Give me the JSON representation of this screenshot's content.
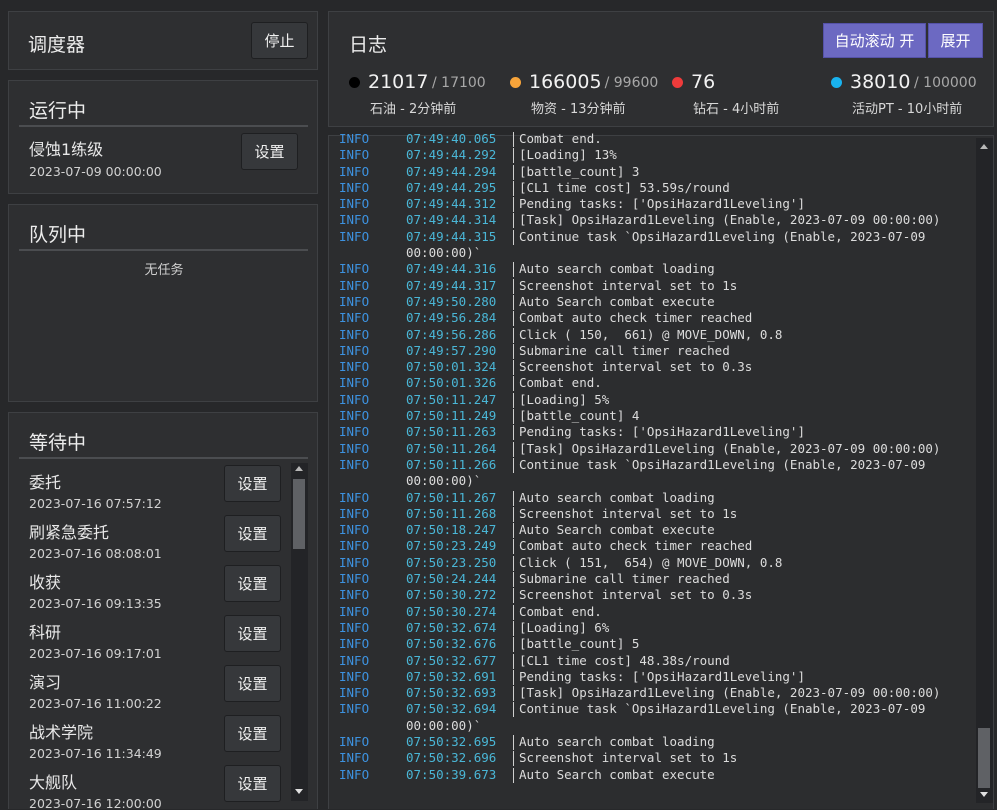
{
  "scheduler": {
    "title": "调度器",
    "stop_label": "停止"
  },
  "running": {
    "title": "运行中",
    "task": {
      "name": "侵蚀1练级",
      "date": "2023-07-09 00:00:00",
      "settings_label": "设置"
    }
  },
  "queue": {
    "title": "队列中",
    "empty_text": "无任务"
  },
  "waiting": {
    "title": "等待中",
    "items": [
      {
        "name": "委托",
        "date": "2023-07-16 07:57:12",
        "settings_label": "设置"
      },
      {
        "name": "刷紧急委托",
        "date": "2023-07-16 08:08:01",
        "settings_label": "设置"
      },
      {
        "name": "收获",
        "date": "2023-07-16 09:13:35",
        "settings_label": "设置"
      },
      {
        "name": "科研",
        "date": "2023-07-16 09:17:01",
        "settings_label": "设置"
      },
      {
        "name": "演习",
        "date": "2023-07-16 11:00:22",
        "settings_label": "设置"
      },
      {
        "name": "战术学院",
        "date": "2023-07-16 11:34:49",
        "settings_label": "设置"
      },
      {
        "name": "大舰队",
        "date": "2023-07-16 12:00:00",
        "settings_label": "设置"
      }
    ]
  },
  "log_panel": {
    "title": "日志",
    "auto_scroll_label": "自动滚动 开",
    "expand_label": "展开",
    "stats": [
      {
        "value": "21017",
        "limit": "/ 17100",
        "label": "石油 - 2分钟前",
        "color": "#000000"
      },
      {
        "value": "166005",
        "limit": "/ 99600",
        "label": "物资 - 13分钟前",
        "color": "#f7a43a"
      },
      {
        "value": "76",
        "limit": "",
        "label": "钻石 - 4小时前",
        "color": "#ee3b3b"
      },
      {
        "value": "38010",
        "limit": "/ 100000",
        "label": "活动PT - 10小时前",
        "color": "#19b3ef"
      }
    ],
    "lines": [
      {
        "level": "INFO",
        "time": "07:49:40.065",
        "msg": "Combat end."
      },
      {
        "level": "INFO",
        "time": "07:49:44.292",
        "msg": "[Loading] 13%"
      },
      {
        "level": "INFO",
        "time": "07:49:44.294",
        "msg": "[battle_count] 3"
      },
      {
        "level": "INFO",
        "time": "07:49:44.295",
        "msg": "[CL1 time cost] 53.59s/round"
      },
      {
        "level": "INFO",
        "time": "07:49:44.312",
        "msg": "Pending tasks: ['OpsiHazard1Leveling']"
      },
      {
        "level": "INFO",
        "time": "07:49:44.314",
        "msg": "[Task] OpsiHazard1Leveling (Enable, 2023-07-09 00:00:00)"
      },
      {
        "level": "INFO",
        "time": "07:49:44.315",
        "msg": "Continue task `OpsiHazard1Leveling (Enable, 2023-07-09"
      },
      {
        "level": "",
        "time": "",
        "msg": "",
        "cont": "00:00:00)`"
      },
      {
        "level": "INFO",
        "time": "07:49:44.316",
        "msg": "Auto search combat loading"
      },
      {
        "level": "INFO",
        "time": "07:49:44.317",
        "msg": "Screenshot interval set to 1s"
      },
      {
        "level": "INFO",
        "time": "07:49:50.280",
        "msg": "Auto Search combat execute"
      },
      {
        "level": "INFO",
        "time": "07:49:56.284",
        "msg": "Combat auto check timer reached"
      },
      {
        "level": "INFO",
        "time": "07:49:56.286",
        "msg": "Click ( 150,  661) @ MOVE_DOWN, 0.8"
      },
      {
        "level": "INFO",
        "time": "07:49:57.290",
        "msg": "Submarine call timer reached"
      },
      {
        "level": "INFO",
        "time": "07:50:01.324",
        "msg": "Screenshot interval set to 0.3s"
      },
      {
        "level": "INFO",
        "time": "07:50:01.326",
        "msg": "Combat end."
      },
      {
        "level": "INFO",
        "time": "07:50:11.247",
        "msg": "[Loading] 5%"
      },
      {
        "level": "INFO",
        "time": "07:50:11.249",
        "msg": "[battle_count] 4"
      },
      {
        "level": "INFO",
        "time": "07:50:11.263",
        "msg": "Pending tasks: ['OpsiHazard1Leveling']"
      },
      {
        "level": "INFO",
        "time": "07:50:11.264",
        "msg": "[Task] OpsiHazard1Leveling (Enable, 2023-07-09 00:00:00)"
      },
      {
        "level": "INFO",
        "time": "07:50:11.266",
        "msg": "Continue task `OpsiHazard1Leveling (Enable, 2023-07-09"
      },
      {
        "level": "",
        "time": "",
        "msg": "",
        "cont": "00:00:00)`"
      },
      {
        "level": "INFO",
        "time": "07:50:11.267",
        "msg": "Auto search combat loading"
      },
      {
        "level": "INFO",
        "time": "07:50:11.268",
        "msg": "Screenshot interval set to 1s"
      },
      {
        "level": "INFO",
        "time": "07:50:18.247",
        "msg": "Auto Search combat execute"
      },
      {
        "level": "INFO",
        "time": "07:50:23.249",
        "msg": "Combat auto check timer reached"
      },
      {
        "level": "INFO",
        "time": "07:50:23.250",
        "msg": "Click ( 151,  654) @ MOVE_DOWN, 0.8"
      },
      {
        "level": "INFO",
        "time": "07:50:24.244",
        "msg": "Submarine call timer reached"
      },
      {
        "level": "INFO",
        "time": "07:50:30.272",
        "msg": "Screenshot interval set to 0.3s"
      },
      {
        "level": "INFO",
        "time": "07:50:30.274",
        "msg": "Combat end."
      },
      {
        "level": "INFO",
        "time": "07:50:32.674",
        "msg": "[Loading] 6%"
      },
      {
        "level": "INFO",
        "time": "07:50:32.676",
        "msg": "[battle_count] 5"
      },
      {
        "level": "INFO",
        "time": "07:50:32.677",
        "msg": "[CL1 time cost] 48.38s/round"
      },
      {
        "level": "INFO",
        "time": "07:50:32.691",
        "msg": "Pending tasks: ['OpsiHazard1Leveling']"
      },
      {
        "level": "INFO",
        "time": "07:50:32.693",
        "msg": "[Task] OpsiHazard1Leveling (Enable, 2023-07-09 00:00:00)"
      },
      {
        "level": "INFO",
        "time": "07:50:32.694",
        "msg": "Continue task `OpsiHazard1Leveling (Enable, 2023-07-09"
      },
      {
        "level": "",
        "time": "",
        "msg": "",
        "cont": "00:00:00)`"
      },
      {
        "level": "INFO",
        "time": "07:50:32.695",
        "msg": "Auto search combat loading"
      },
      {
        "level": "INFO",
        "time": "07:50:32.696",
        "msg": "Screenshot interval set to 1s"
      },
      {
        "level": "INFO",
        "time": "07:50:39.673",
        "msg": "Auto Search combat execute"
      }
    ]
  }
}
